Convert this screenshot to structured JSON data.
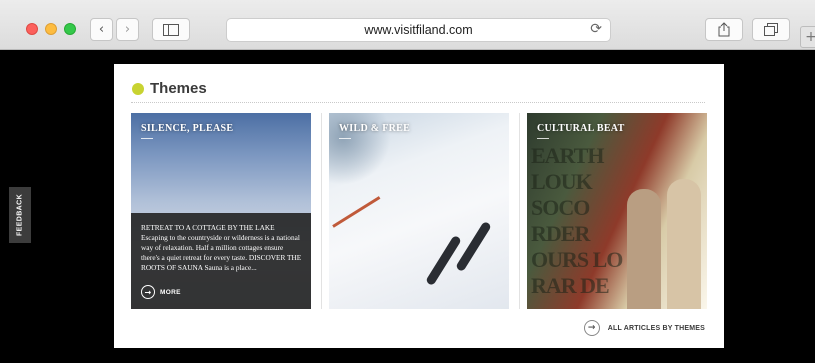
{
  "browser": {
    "url": "www.visitfiland.com",
    "back_icon": "chevron-left-icon",
    "forward_icon": "chevron-right-icon",
    "reload_icon": "reload-icon"
  },
  "feedback_label": "FEEDBACK",
  "section": {
    "title": "Themes",
    "accent_color": "#c8d331"
  },
  "cards": [
    {
      "title": "SILENCE, PLEASE",
      "overlay_text": "RETREAT TO A COTTAGE BY THE LAKE Escaping to the countryside or wilderness is a national way of relaxation. Half a million cottages ensure there's a quiet retreat for every taste. DISCOVER THE ROOTS OF SAUNA Sauna is a place...",
      "more_label": "MORE"
    },
    {
      "title": "WILD & FREE"
    },
    {
      "title": "CULTURAL BEAT",
      "graffiti_text": "EARTH LOUK SOCO RDER OURS LO RAR DE"
    }
  ],
  "footer": {
    "all_articles_label": "ALL ARTICLES BY THEMES"
  }
}
